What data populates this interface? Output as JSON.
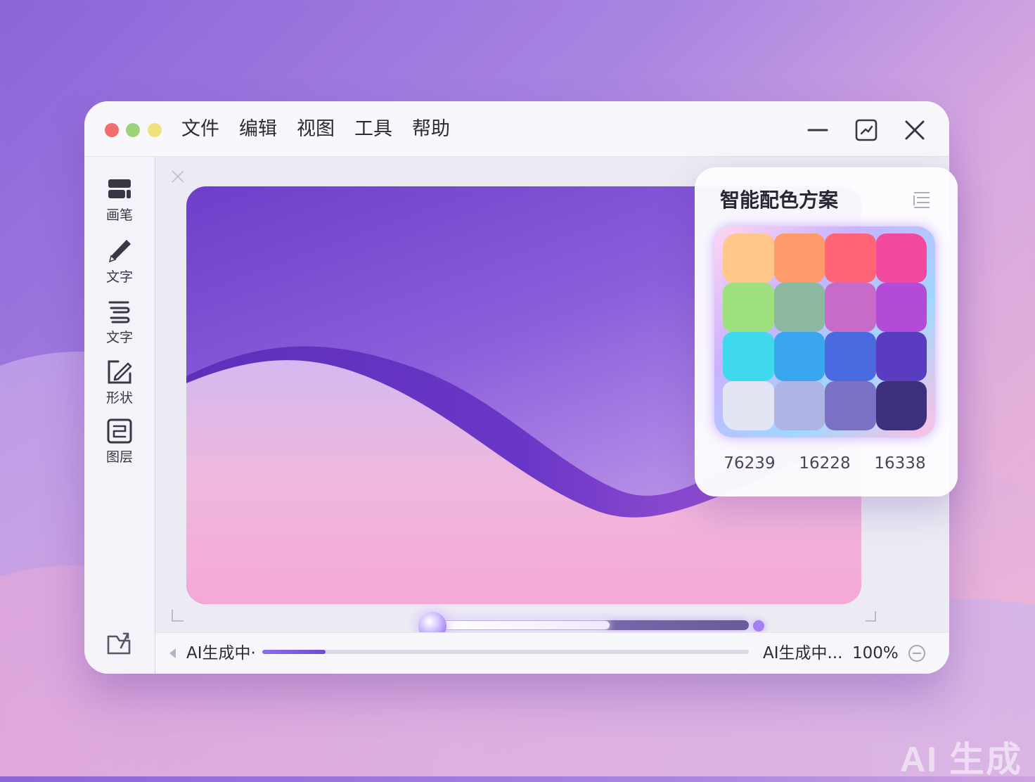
{
  "window": {
    "menu": [
      "文件",
      "编辑",
      "视图",
      "工具",
      "帮助"
    ]
  },
  "sidebar": {
    "tools": [
      {
        "label": "画笔",
        "icon": "brush-stack-icon"
      },
      {
        "label": "文字",
        "icon": "pen-icon"
      },
      {
        "label": "文字",
        "icon": "text-lines-icon"
      },
      {
        "label": "形状",
        "icon": "shape-edit-icon"
      },
      {
        "label": "图层",
        "icon": "layers-icon"
      }
    ],
    "bottom_icon": "folder-export-icon"
  },
  "canvas": {
    "slider_level": 0.55
  },
  "statusbar": {
    "left_text": "AI生成中·",
    "progress": 0.13,
    "right_text": "AI生成中...",
    "zoom": "100%"
  },
  "palette_panel": {
    "title": "智能配色方案",
    "swatches": [
      "#ffc88a",
      "#ff9a6a",
      "#ff6477",
      "#f2489e",
      "#9ee07e",
      "#8cb8a2",
      "#c86ac8",
      "#b44ad8",
      "#3fd8ec",
      "#3aa6f0",
      "#4a6ae0",
      "#5a3cc0",
      "#e2e6f4",
      "#aeb4e4",
      "#7a70c4",
      "#3e2f7a"
    ],
    "codes": [
      "76239",
      "16228",
      "16338"
    ]
  },
  "watermark": "AI 生成",
  "colors": {
    "accent": "#8e6cf0",
    "close_dot": "#f26d6d",
    "min_dot": "#9fd37a",
    "zoom_dot": "#f1e17e"
  }
}
